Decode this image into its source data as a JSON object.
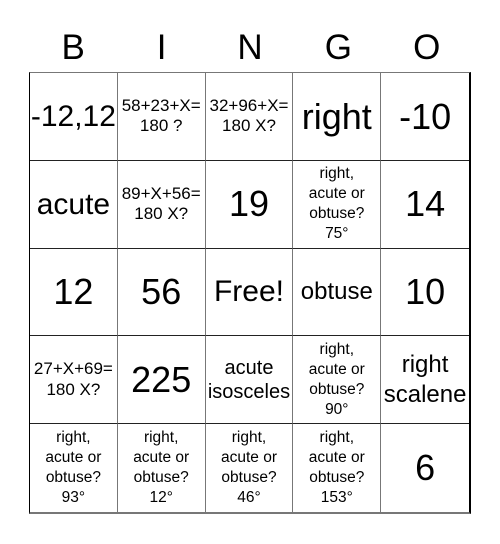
{
  "header": {
    "letters": [
      "B",
      "I",
      "N",
      "G",
      "O"
    ]
  },
  "board": {
    "cells": [
      {
        "text": "-12,12",
        "size": "s-l"
      },
      {
        "text": "58+23+X=\n180 ?",
        "size": "s-sm"
      },
      {
        "text": "32+96+X=\n180 X?",
        "size": "s-sm"
      },
      {
        "text": "right",
        "size": "s-xl"
      },
      {
        "text": "-10",
        "size": "s-xl"
      },
      {
        "text": "acute",
        "size": "s-l"
      },
      {
        "text": "89+X+56=\n180 X?",
        "size": "s-sm"
      },
      {
        "text": "19",
        "size": "s-xl"
      },
      {
        "text": "right,\nacute or\nobtuse?\n75°",
        "size": "s-xs"
      },
      {
        "text": "14",
        "size": "s-xl"
      },
      {
        "text": "12",
        "size": "s-xl"
      },
      {
        "text": "56",
        "size": "s-xl"
      },
      {
        "text": "Free!",
        "size": "s-l"
      },
      {
        "text": "obtuse",
        "size": "s-m"
      },
      {
        "text": "10",
        "size": "s-xl"
      },
      {
        "text": "27+X+69=\n180 X?",
        "size": "s-sm"
      },
      {
        "text": "225",
        "size": "s-xl"
      },
      {
        "text": "acute\nisosceles",
        "size": "s-md"
      },
      {
        "text": "right,\nacute or\nobtuse?\n90°",
        "size": "s-xs"
      },
      {
        "text": "right\nscalene",
        "size": "s-m"
      },
      {
        "text": "right,\nacute or\nobtuse?\n93°",
        "size": "s-xs"
      },
      {
        "text": "right,\nacute or\nobtuse?\n12°",
        "size": "s-xs"
      },
      {
        "text": "right,\nacute or\nobtuse?\n46°",
        "size": "s-xs"
      },
      {
        "text": "right,\nacute or\nobtuse?\n153°",
        "size": "s-xs"
      },
      {
        "text": "6",
        "size": "s-xl"
      }
    ]
  }
}
